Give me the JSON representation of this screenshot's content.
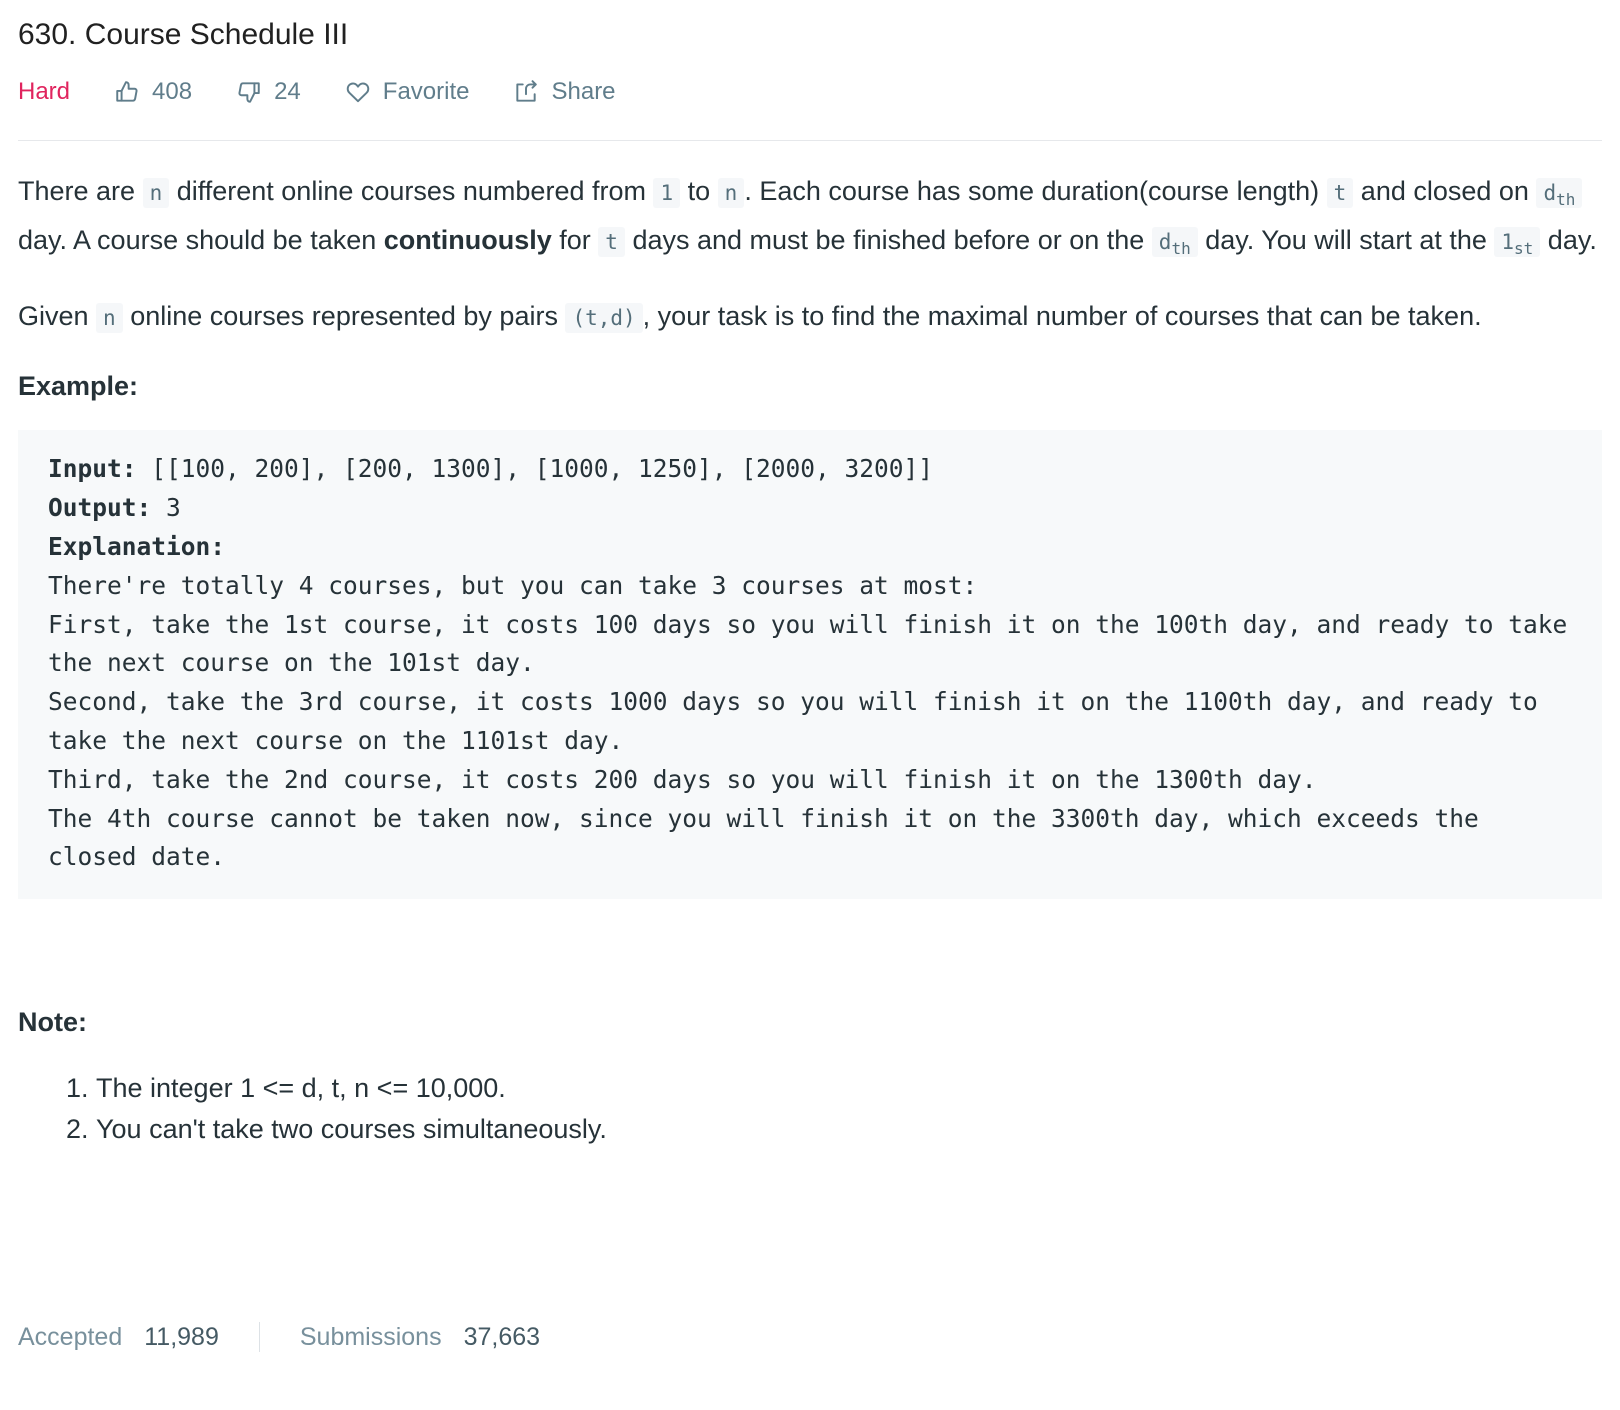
{
  "problem": {
    "title": "630. Course Schedule III",
    "difficulty": "Hard",
    "likes": "408",
    "dislikes": "24",
    "favorite_label": "Favorite",
    "share_label": "Share",
    "colors": {
      "difficulty": "#e0245e",
      "meta": "#607d8b"
    }
  },
  "description": {
    "p1": {
      "t1": "There are ",
      "c1": "n",
      "t2": " different online courses numbered from ",
      "c2": "1",
      "t3": " to ",
      "c3": "n",
      "t4": ". Each course has some duration(course length) ",
      "c4": "t",
      "t5": " and closed on ",
      "c5_base": "d",
      "c5_sub": "th",
      "t6": " day. A course should be taken ",
      "strong": "continuously",
      "t7": " for ",
      "c6": "t",
      "t8": " days and must be finished before or on the ",
      "c7_base": "d",
      "c7_sub": "th",
      "t9": " day. You will start at the ",
      "c8_base": "1",
      "c8_sub": "st",
      "t10": " day."
    },
    "p2": {
      "t1": "Given ",
      "c1": "n",
      "t2": " online courses represented by pairs ",
      "c2": "(t,d)",
      "t3": ", your task is to find the maximal number of courses that can be taken."
    }
  },
  "example": {
    "heading": "Example:",
    "input_label": "Input:",
    "input_value": " [[100, 200], [200, 1300], [1000, 1250], [2000, 3200]]",
    "output_label": "Output:",
    "output_value": " 3",
    "explanation_label": "Explanation:",
    "explanation_lines": [
      "There're totally 4 courses, but you can take 3 courses at most:",
      "First, take the 1st course, it costs 100 days so you will finish it on the 100th day, and ready to take the next course on the 101st day.",
      "Second, take the 3rd course, it costs 1000 days so you will finish it on the 1100th day, and ready to take the next course on the 1101st day. ",
      "Third, take the 2nd course, it costs 200 days so you will finish it on the 1300th day. ",
      "The 4th course cannot be taken now, since you will finish it on the 3300th day, which exceeds the closed date."
    ]
  },
  "note": {
    "heading": "Note:",
    "items": [
      "The integer 1 <= d, t, n <= 10,000.",
      "You can't take two courses simultaneously."
    ]
  },
  "stats": {
    "accepted_label": "Accepted",
    "accepted_value": "11,989",
    "submissions_label": "Submissions",
    "submissions_value": "37,663"
  }
}
